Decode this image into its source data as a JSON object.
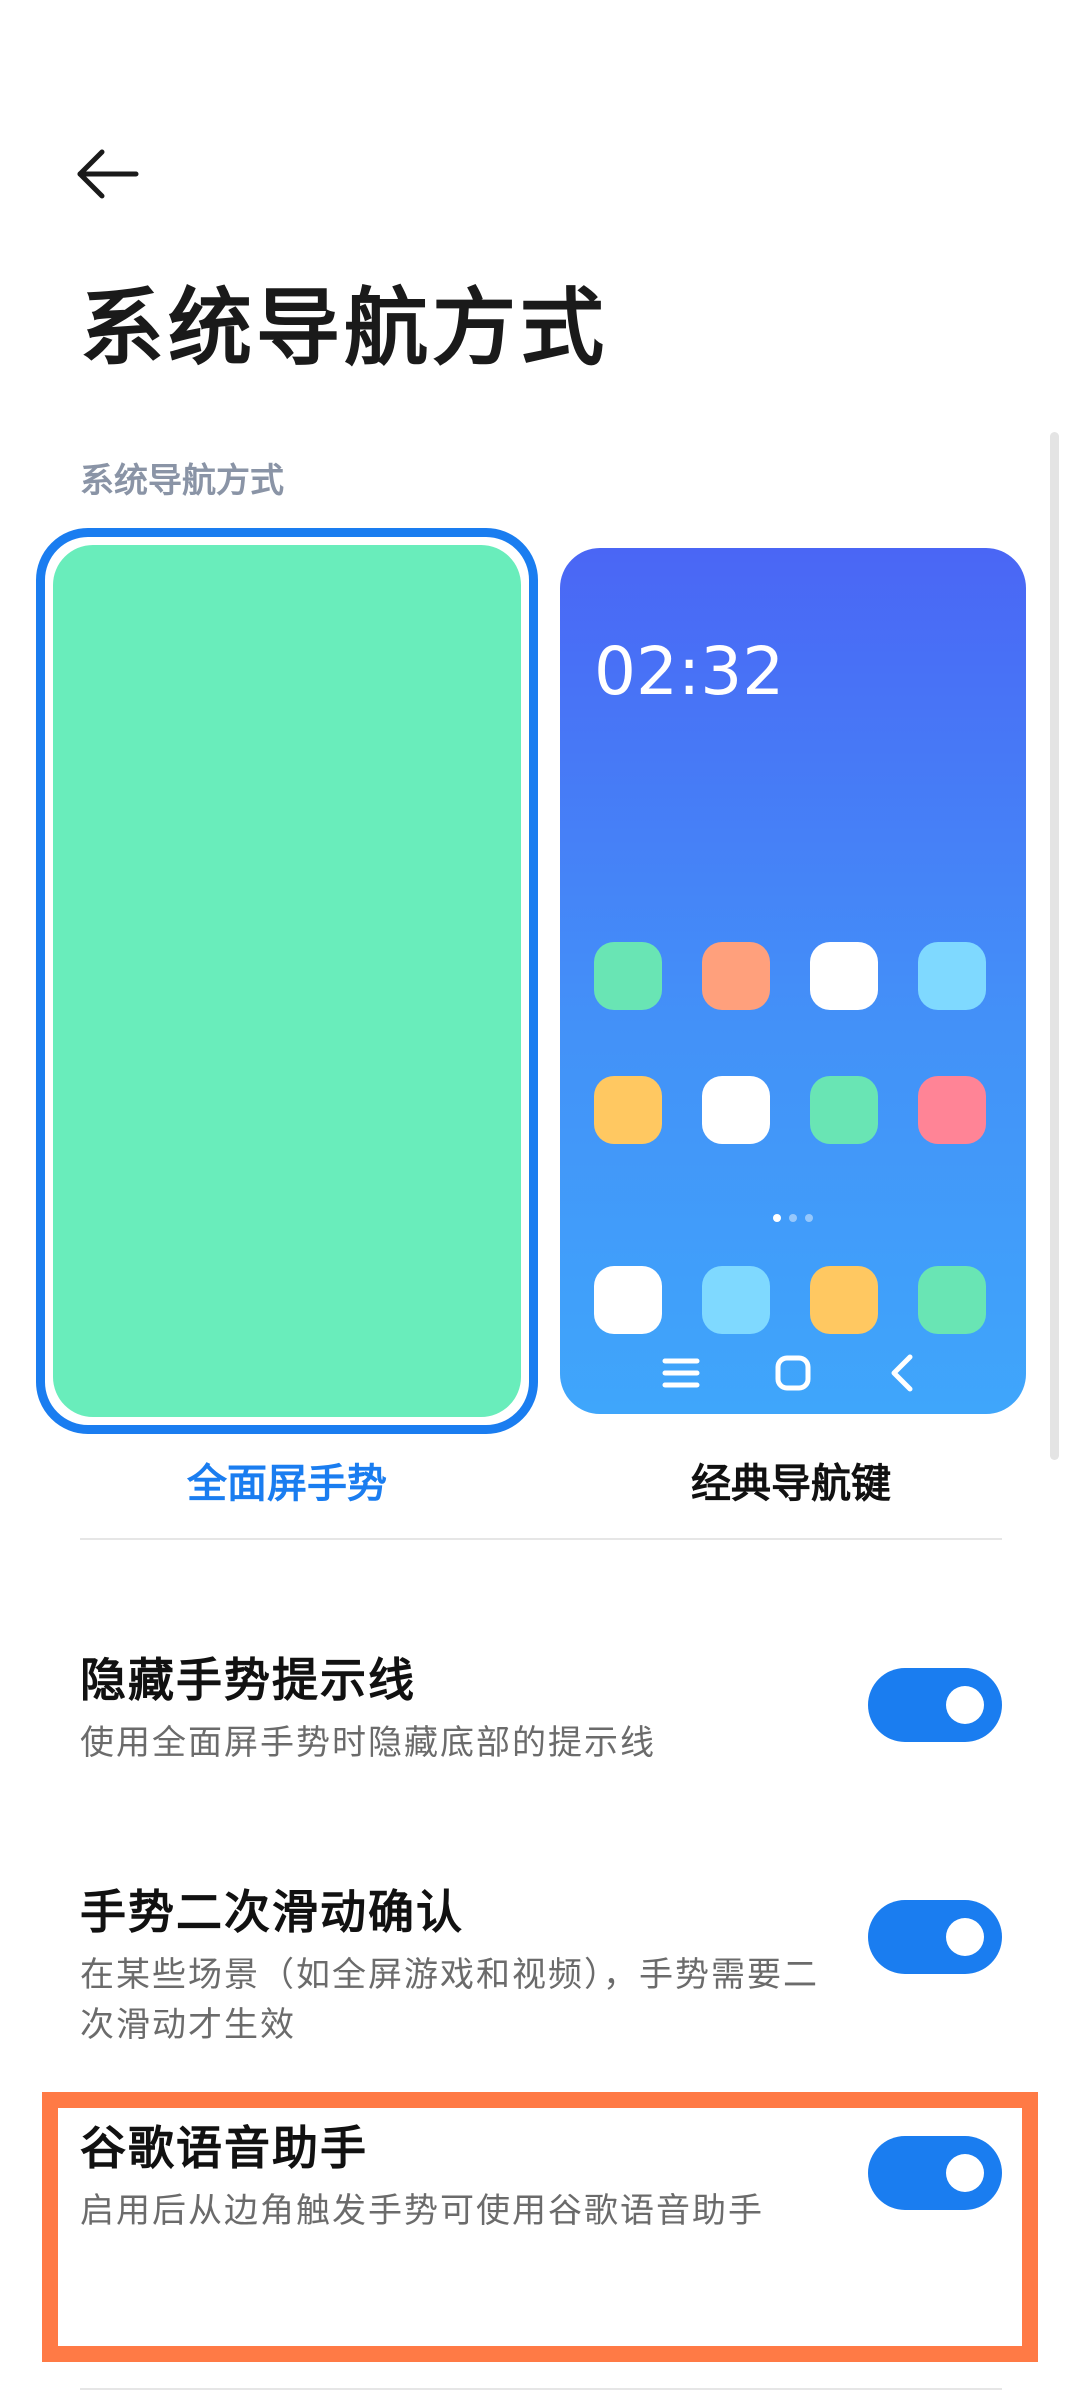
{
  "header": {
    "back_icon": "arrow-left-icon",
    "title": "系统导航方式"
  },
  "section": {
    "label": "系统导航方式"
  },
  "options": {
    "gesture": {
      "label": "全面屏手势",
      "selected": true
    },
    "classic": {
      "label": "经典导航键",
      "selected": false,
      "preview_time": "02:32"
    }
  },
  "settings": [
    {
      "title": "隐藏手势提示线",
      "description": "使用全面屏手势时隐藏底部的提示线",
      "enabled": true
    },
    {
      "title": "手势二次滑动确认",
      "description": "在某些场景（如全屏游戏和视频），手势需要二次滑动才生效",
      "enabled": true
    },
    {
      "title": "谷歌语音助手",
      "description": "启用后从边角触发手势可使用谷歌语音助手",
      "enabled": true
    }
  ],
  "colors": {
    "accent": "#1a7df0",
    "highlight": "#ff7a45",
    "gesture_preview": "#69edbb"
  }
}
